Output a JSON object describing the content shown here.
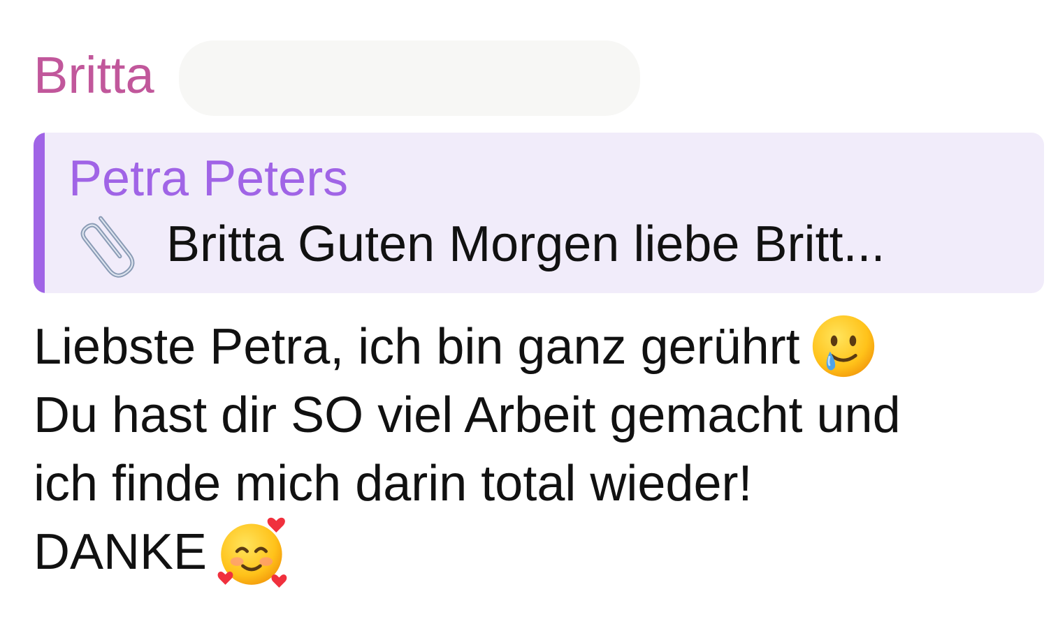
{
  "message": {
    "sender": "Britta",
    "reply": {
      "author": "Petra Peters",
      "attachment_icon": "paperclip-icon",
      "preview": "Britta Guten Morgen liebe Britt..."
    },
    "body": {
      "line1": "Liebste Petra, ich bin ganz gerührt",
      "line1_emoji": "smiling-face-with-tear-icon",
      "line2": "Du hast dir SO viel Arbeit gemacht und",
      "line3": "ich finde mich darin total wieder!",
      "line4": "DANKE",
      "line4_emoji": "smiling-face-with-hearts-icon"
    }
  },
  "colors": {
    "sender_name": "#c1579b",
    "reply_accent": "#a064e6",
    "reply_background": "#f1ecfa",
    "text": "#111111"
  }
}
